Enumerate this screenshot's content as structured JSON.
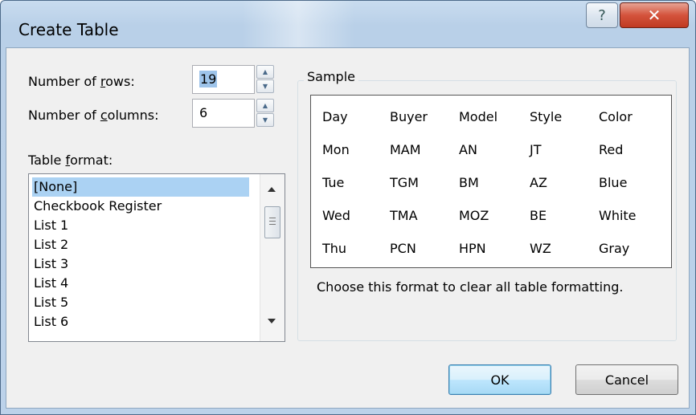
{
  "window": {
    "title": "Create Table"
  },
  "titlebar": {
    "help_label": "?",
    "close_label": "✕"
  },
  "rows": {
    "label_pre": "Number of ",
    "label_u": "r",
    "label_post": "ows:",
    "value": "19"
  },
  "columns": {
    "label_pre": "Number of ",
    "label_u": "c",
    "label_post": "olumns:",
    "value": "6"
  },
  "spinner": {
    "up": "▲",
    "down": "▼"
  },
  "format": {
    "label_pre": "Table ",
    "label_u": "f",
    "label_post": "ormat:",
    "items": [
      "[None]",
      "Checkbook Register",
      "List 1",
      "List 2",
      "List 3",
      "List 4",
      "List 5",
      "List 6"
    ],
    "selected_index": 0
  },
  "sample": {
    "title": "Sample",
    "table": [
      [
        "Day",
        "Buyer",
        "Model",
        "Style",
        "Color"
      ],
      [
        "Mon",
        "MAM",
        "AN",
        "JT",
        "Red"
      ],
      [
        "Tue",
        "TGM",
        "BM",
        "AZ",
        "Blue"
      ],
      [
        "Wed",
        "TMA",
        "MOZ",
        "BE",
        "White"
      ],
      [
        "Thu",
        "PCN",
        "HPN",
        "WZ",
        "Gray"
      ]
    ],
    "description": "Choose this format to clear all table formatting."
  },
  "buttons": {
    "ok": "OK",
    "cancel": "Cancel"
  }
}
